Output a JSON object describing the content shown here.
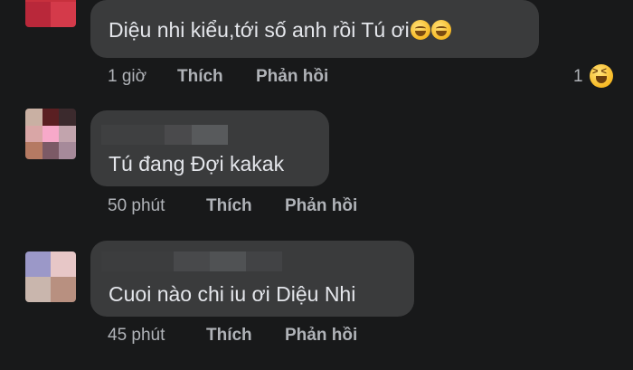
{
  "comments": [
    {
      "text": "Diệu nhi kiểu,tới số anh rồi Tú ơi",
      "emoji": [
        "rofl-emoji",
        "rofl-emoji"
      ],
      "time": "1 giờ",
      "like_label": "Thích",
      "reply_label": "Phản hồi",
      "reaction_count": "1",
      "reaction_icon": "laughing-emoji"
    },
    {
      "text": "Tú đang Đợi kakak",
      "time": "50 phút",
      "like_label": "Thích",
      "reply_label": "Phản hồi"
    },
    {
      "text": "Cuoi nào chi iu ơi Diệu Nhi",
      "time": "45 phút",
      "like_label": "Thích",
      "reply_label": "Phản hồi"
    }
  ],
  "colors": {
    "background": "#18191a",
    "bubble": "#3a3b3c",
    "text": "#e4e6eb",
    "meta": "#b0b3b8"
  }
}
